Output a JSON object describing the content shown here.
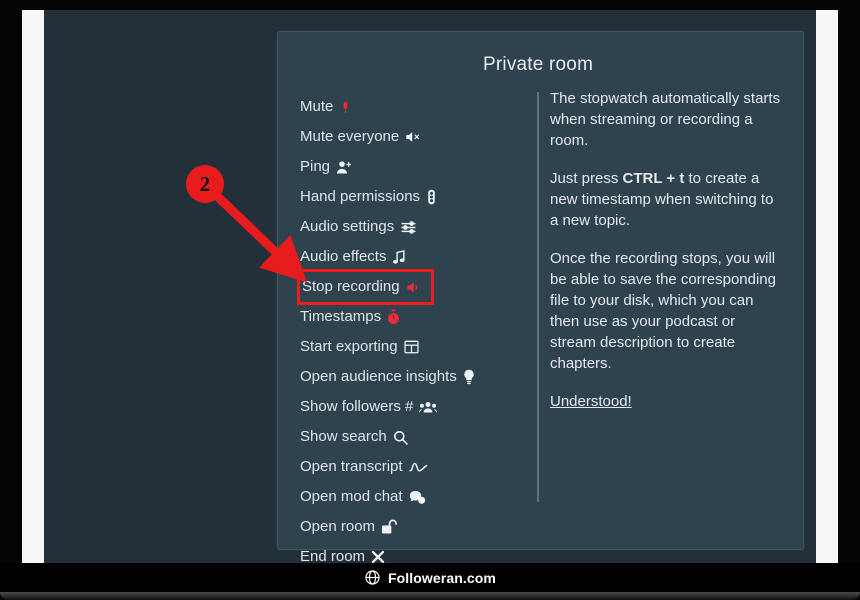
{
  "panel": {
    "title": "Private room",
    "menu": [
      {
        "label": "Mute",
        "icon": "microphone-icon",
        "glyph": "🎙",
        "color": "red"
      },
      {
        "label": "Mute everyone",
        "icon": "speaker-mute-icon",
        "glyph": "🔇",
        "color": "white"
      },
      {
        "label": "Ping",
        "icon": "person-add-icon",
        "glyph": "👤",
        "color": "white"
      },
      {
        "label": "Hand permissions",
        "icon": "traffic-light-icon",
        "glyph": "🚦",
        "color": "white"
      },
      {
        "label": "Audio settings",
        "icon": "sliders-icon",
        "glyph": "☲",
        "color": "white"
      },
      {
        "label": "Audio effects",
        "icon": "music-note-icon",
        "glyph": "♫",
        "color": "white"
      },
      {
        "label": "Stop recording",
        "icon": "speaker-icon",
        "glyph": "🔈",
        "color": "red",
        "highlighted": true
      },
      {
        "label": "Timestamps",
        "icon": "stopwatch-icon",
        "glyph": "⏱",
        "color": "red"
      },
      {
        "label": "Start exporting",
        "icon": "table-grid-icon",
        "glyph": "⊞",
        "color": "white"
      },
      {
        "label": "Open audience insights",
        "icon": "lightbulb-icon",
        "glyph": "💡",
        "color": "white"
      },
      {
        "label": "Show followers #",
        "icon": "people-group-icon",
        "glyph": "👥",
        "color": "white"
      },
      {
        "label": "Show search",
        "icon": "search-icon",
        "glyph": "🔍",
        "color": "white"
      },
      {
        "label": "Open transcript",
        "icon": "squiggle-line-icon",
        "glyph": "〜",
        "color": "white"
      },
      {
        "label": "Open mod chat",
        "icon": "chat-bubbles-icon",
        "glyph": "💬",
        "color": "white"
      },
      {
        "label": "Open room",
        "icon": "unlocked-padlock-icon",
        "glyph": "🔓",
        "color": "white"
      },
      {
        "label": "End room",
        "icon": "close-x-icon",
        "glyph": "✖",
        "color": "white"
      }
    ],
    "info": {
      "paragraph_1": "The stopwatch automatically starts when streaming or recording a room.",
      "paragraph_2_before": "Just press ",
      "paragraph_2_kbd": "CTRL + t",
      "paragraph_2_after": " to create a new timestamp when switching to a new topic.",
      "paragraph_3": "Once the recording stops, you will be able to save the corresponding file to your disk, which you can then use as your podcast or stream description to create chapters.",
      "understood_link": "Understood!"
    }
  },
  "annotation": {
    "step_number": "2",
    "points_to": "Stop recording",
    "color": "#e81c1c"
  },
  "watermark": {
    "text": "Followeran.com",
    "icon": "globe-icon"
  },
  "colors": {
    "app_background": "#233039",
    "panel_background": "#2f434e",
    "panel_border": "#41555f",
    "text": "#e4eaee",
    "accent_red": "#ee1c1c",
    "divider": "#5d717c",
    "page_white": "#f7f7f7"
  }
}
